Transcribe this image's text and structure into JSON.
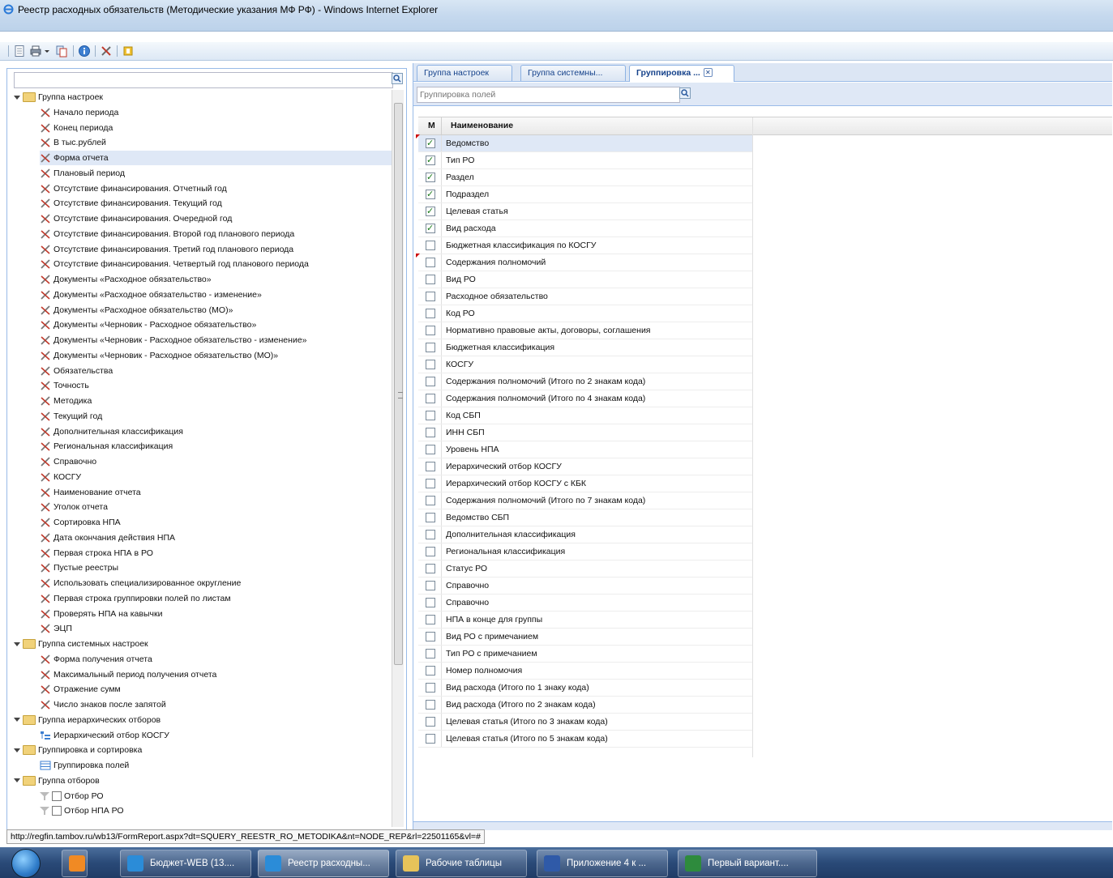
{
  "window": {
    "title": "Реестр расходных обязательств (Методические указания МФ РФ) - Windows Internet Explorer"
  },
  "toolbar": {
    "icons": [
      "page-icon",
      "print-icon",
      "dropdown-arrow-icon",
      "copy-icon",
      "info-icon",
      "tools-icon",
      "export-icon"
    ]
  },
  "left": {
    "search_value": "",
    "tree": [
      {
        "label": "Группа настроек",
        "type": "group",
        "level": 0
      },
      {
        "label": "Начало периода",
        "type": "setting",
        "level": 1
      },
      {
        "label": "Конец периода",
        "type": "setting",
        "level": 1
      },
      {
        "label": "В тыс.рублей",
        "type": "setting",
        "level": 1
      },
      {
        "label": "Форма отчета",
        "type": "setting",
        "level": 1,
        "selected": true
      },
      {
        "label": "Плановый период",
        "type": "setting",
        "level": 1
      },
      {
        "label": "Отсутствие финансирования. Отчетный год",
        "type": "setting",
        "level": 1
      },
      {
        "label": "Отсутствие финансирования. Текущий год",
        "type": "setting",
        "level": 1
      },
      {
        "label": "Отсутствие финансирования. Очередной год",
        "type": "setting",
        "level": 1
      },
      {
        "label": "Отсутствие финансирования. Второй год планового периода",
        "type": "setting",
        "level": 1
      },
      {
        "label": "Отсутствие финансирования. Третий год планового периода",
        "type": "setting",
        "level": 1
      },
      {
        "label": "Отсутствие финансирования. Четвертый год планового периода",
        "type": "setting",
        "level": 1
      },
      {
        "label": "Документы «Расходное обязательство»",
        "type": "setting",
        "level": 1
      },
      {
        "label": "Документы «Расходное обязательство - изменение»",
        "type": "setting",
        "level": 1
      },
      {
        "label": "Документы «Расходное обязательство (МО)»",
        "type": "setting",
        "level": 1
      },
      {
        "label": "Документы «Черновик - Расходное обязательство»",
        "type": "setting",
        "level": 1
      },
      {
        "label": "Документы «Черновик - Расходное обязательство - изменение»",
        "type": "setting",
        "level": 1
      },
      {
        "label": "Документы «Черновик - Расходное обязательство (МО)»",
        "type": "setting",
        "level": 1
      },
      {
        "label": "Обязательства",
        "type": "setting",
        "level": 1
      },
      {
        "label": "Точность",
        "type": "setting",
        "level": 1
      },
      {
        "label": "Методика",
        "type": "setting",
        "level": 1
      },
      {
        "label": "Текущий год",
        "type": "setting",
        "level": 1
      },
      {
        "label": "Дополнительная классификация",
        "type": "setting",
        "level": 1
      },
      {
        "label": "Региональная классификация",
        "type": "setting",
        "level": 1
      },
      {
        "label": "Справочно",
        "type": "setting",
        "level": 1
      },
      {
        "label": "КОСГУ",
        "type": "setting",
        "level": 1
      },
      {
        "label": "Наименование отчета",
        "type": "setting",
        "level": 1
      },
      {
        "label": "Уголок отчета",
        "type": "setting",
        "level": 1
      },
      {
        "label": "Сортировка НПА",
        "type": "setting",
        "level": 1
      },
      {
        "label": "Дата окончания действия НПА",
        "type": "setting",
        "level": 1
      },
      {
        "label": "Первая строка НПА в РО",
        "type": "setting",
        "level": 1
      },
      {
        "label": "Пустые реестры",
        "type": "setting",
        "level": 1
      },
      {
        "label": "Использовать специализированное округление",
        "type": "setting",
        "level": 1
      },
      {
        "label": "Первая строка группировки полей по листам",
        "type": "setting",
        "level": 1
      },
      {
        "label": "Проверять НПА на кавычки",
        "type": "setting",
        "level": 1
      },
      {
        "label": "ЭЦП",
        "type": "setting",
        "level": 1
      },
      {
        "label": "Группа системных настроек",
        "type": "group",
        "level": 0
      },
      {
        "label": "Форма получения отчета",
        "type": "setting",
        "level": 1
      },
      {
        "label": "Максимальный период получения отчета",
        "type": "setting",
        "level": 1
      },
      {
        "label": "Отражение сумм",
        "type": "setting",
        "level": 1
      },
      {
        "label": "Число знаков после запятой",
        "type": "setting",
        "level": 1
      },
      {
        "label": "Группа иерархических отборов",
        "type": "group",
        "level": 0
      },
      {
        "label": "Иерархический отбор КОСГУ",
        "type": "hier",
        "level": 1
      },
      {
        "label": "Группировка и сортировка",
        "type": "group",
        "level": 0
      },
      {
        "label": "Группировка полей",
        "type": "grid",
        "level": 1
      },
      {
        "label": "Группа отборов",
        "type": "group",
        "level": 0
      },
      {
        "label": "Отбор РО",
        "type": "filter",
        "level": 1
      },
      {
        "label": "Отбор НПА РО",
        "type": "filter",
        "level": 1
      }
    ]
  },
  "right": {
    "tabs": [
      {
        "label": "Группа настроек",
        "active": false
      },
      {
        "label": "Группа системны...",
        "active": false
      },
      {
        "label": "Группировка ...",
        "active": true,
        "closable": true
      }
    ],
    "search_placeholder": "Группировка полей",
    "grid": {
      "columns": [
        "М",
        "Наименование"
      ],
      "rows": [
        {
          "name": "Ведомство",
          "checked": true,
          "flag": true
        },
        {
          "name": "Тип РО",
          "checked": true
        },
        {
          "name": "Раздел",
          "checked": true
        },
        {
          "name": "Подраздел",
          "checked": true
        },
        {
          "name": "Целевая статья",
          "checked": true
        },
        {
          "name": "Вид расхода",
          "checked": true
        },
        {
          "name": "Бюджетная классификация по КОСГУ",
          "checked": false
        },
        {
          "name": "Содержания полномочий",
          "checked": false,
          "flag": true
        },
        {
          "name": "Вид РО",
          "checked": false
        },
        {
          "name": "Расходное обязательство",
          "checked": false
        },
        {
          "name": "Код РО",
          "checked": false
        },
        {
          "name": "Нормативно правовые акты, договоры, соглашения",
          "checked": false
        },
        {
          "name": "Бюджетная классификация",
          "checked": false
        },
        {
          "name": "КОСГУ",
          "checked": false
        },
        {
          "name": "Содержания полномочий (Итого по 2 знакам кода)",
          "checked": false
        },
        {
          "name": "Содержания полномочий (Итого по 4 знакам кода)",
          "checked": false
        },
        {
          "name": "Код СБП",
          "checked": false
        },
        {
          "name": "ИНН СБП",
          "checked": false
        },
        {
          "name": "Уровень НПА",
          "checked": false
        },
        {
          "name": "Иерархический отбор КОСГУ",
          "checked": false
        },
        {
          "name": "Иерархический отбор КОСГУ с КБК",
          "checked": false
        },
        {
          "name": "Содержания полномочий (Итого по 7 знакам кода)",
          "checked": false
        },
        {
          "name": "Ведомство СБП",
          "checked": false
        },
        {
          "name": "Дополнительная классификация",
          "checked": false
        },
        {
          "name": "Региональная классификация",
          "checked": false
        },
        {
          "name": "Статус РО",
          "checked": false
        },
        {
          "name": "Справочно",
          "checked": false
        },
        {
          "name": "Справочно",
          "checked": false
        },
        {
          "name": "НПА в конце для группы",
          "checked": false
        },
        {
          "name": "Вид РО с примечанием",
          "checked": false
        },
        {
          "name": "Тип РО с примечанием",
          "checked": false
        },
        {
          "name": "Номер полномочия",
          "checked": false
        },
        {
          "name": "Вид расхода (Итого по 1 знаку кода)",
          "checked": false
        },
        {
          "name": "Вид расхода (Итого по 2 знакам кода)",
          "checked": false
        },
        {
          "name": "Целевая статья (Итого по 3 знакам кода)",
          "checked": false
        },
        {
          "name": "Целевая статья (Итого по 5 знакам кода)",
          "checked": false
        }
      ]
    }
  },
  "status_url": "http://regfin.tambov.ru/wb13/FormReport.aspx?dt=SQUERY_REESTR_RO_METODIKA&nt=NODE_REP&rl=22501165&vl=#",
  "taskbar": {
    "items": [
      {
        "label": "",
        "icon": "media-player-icon",
        "active": false
      },
      {
        "label": "Бюджет-WEB (13....",
        "icon": "ie-icon",
        "active": false
      },
      {
        "label": "Реестр расходны...",
        "icon": "ie-icon",
        "active": true
      },
      {
        "label": "Рабочие таблицы",
        "icon": "folder-icon",
        "active": false
      },
      {
        "label": "Приложение 4 к ...",
        "icon": "word-icon",
        "active": false
      },
      {
        "label": "Первый вариант....",
        "icon": "excel-icon",
        "active": false
      }
    ]
  },
  "colors": {
    "panel_border": "#99bbe8",
    "selected_bg": "#dfe8f6",
    "tab_text": "#15428b",
    "check_green": "#1a7a1a"
  }
}
